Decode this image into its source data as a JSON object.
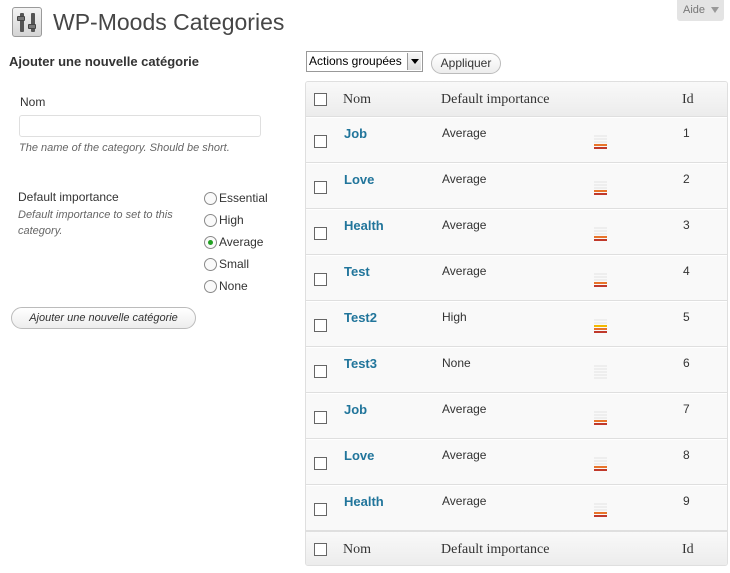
{
  "header": {
    "title": "WP-Moods Categories",
    "help_label": "Aide",
    "icon": "settings-sliders-icon"
  },
  "form": {
    "title": "Ajouter une nouvelle catégorie",
    "name_label": "Nom",
    "name_value": "",
    "name_hint": "The name of the category. Should be short.",
    "importance_label": "Default importance",
    "importance_hint": "Default importance to set to this category.",
    "options": [
      "Essential",
      "High",
      "Average",
      "Small",
      "None"
    ],
    "selected": "Average",
    "submit_label": "Ajouter une nouvelle catégorie"
  },
  "bulk": {
    "select_value": "Actions groupées",
    "apply_label": "Appliquer"
  },
  "table": {
    "columns": {
      "name": "Nom",
      "importance": "Default importance",
      "id": "Id"
    },
    "rows": [
      {
        "name": "Job",
        "importance": "Average",
        "id": "1"
      },
      {
        "name": "Love",
        "importance": "Average",
        "id": "2"
      },
      {
        "name": "Health",
        "importance": "Average",
        "id": "3"
      },
      {
        "name": "Test",
        "importance": "Average",
        "id": "4"
      },
      {
        "name": "Test2",
        "importance": "High",
        "id": "5"
      },
      {
        "name": "Test3",
        "importance": "None",
        "id": "6"
      },
      {
        "name": "Job",
        "importance": "Average",
        "id": "7"
      },
      {
        "name": "Love",
        "importance": "Average",
        "id": "8"
      },
      {
        "name": "Health",
        "importance": "Average",
        "id": "9"
      }
    ]
  },
  "importance_levels": {
    "Essential": 5,
    "High": 3,
    "Average": 2,
    "Small": 1,
    "None": 0
  },
  "colors": {
    "link": "#21759b",
    "bar_empty": "#eeeeee",
    "bar_levels": [
      "#c0392b",
      "#e8742a",
      "#f2b800",
      "#f4d03f",
      "#f6e27a"
    ]
  }
}
